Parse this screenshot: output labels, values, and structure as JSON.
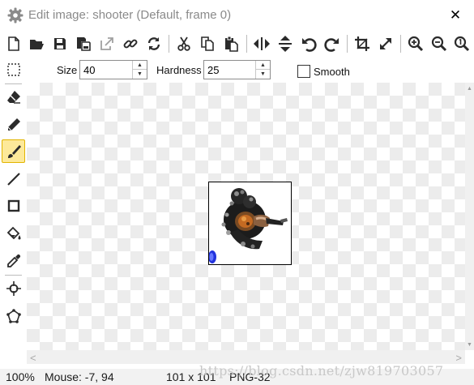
{
  "window": {
    "title": "Edit image: shooter (Default, frame 0)",
    "close_glyph": "✕",
    "app_icon": "gear-icon"
  },
  "toolbar": {
    "buttons": [
      {
        "name": "new-image-button",
        "icon": "new-file-icon"
      },
      {
        "name": "open-button",
        "icon": "folder-open-icon"
      },
      {
        "name": "save-button",
        "icon": "save-icon"
      },
      {
        "name": "save-copy-button",
        "icon": "save-copy-icon"
      },
      {
        "name": "export-button",
        "icon": "export-icon"
      },
      {
        "name": "link-button",
        "icon": "link-icon"
      },
      {
        "name": "refresh-button",
        "icon": "refresh-icon"
      },
      {
        "name": "cut-button",
        "icon": "scissors-icon"
      },
      {
        "name": "copy-button",
        "icon": "copy-icon"
      },
      {
        "name": "paste-button",
        "icon": "paste-icon"
      },
      {
        "name": "flip-horizontal-button",
        "icon": "flip-horizontal-icon"
      },
      {
        "name": "flip-vertical-button",
        "icon": "flip-vertical-icon"
      },
      {
        "name": "undo-button",
        "icon": "undo-icon"
      },
      {
        "name": "redo-button",
        "icon": "redo-icon"
      },
      {
        "name": "crop-button",
        "icon": "crop-icon"
      },
      {
        "name": "resize-button",
        "icon": "resize-icon"
      },
      {
        "name": "zoom-in-button",
        "icon": "zoom-in-icon"
      },
      {
        "name": "zoom-out-button",
        "icon": "zoom-out-icon"
      },
      {
        "name": "zoom-reset-button",
        "icon": "zoom-reset-icon"
      }
    ]
  },
  "options": {
    "size_label": "Size",
    "size_value": "40",
    "hardness_label": "Hardness",
    "hardness_value": "25",
    "smooth_label": "Smooth",
    "smooth_checked": false
  },
  "tools": {
    "active": "brush-tool",
    "items": [
      {
        "name": "select-tool",
        "icon": "marquee-select-icon"
      },
      {
        "name": "eraser-tool",
        "icon": "eraser-icon"
      },
      {
        "name": "pencil-tool",
        "icon": "pencil-icon"
      },
      {
        "name": "brush-tool",
        "icon": "brush-icon"
      },
      {
        "name": "line-tool",
        "icon": "line-icon"
      },
      {
        "name": "rectangle-tool",
        "icon": "rectangle-icon"
      },
      {
        "name": "fill-tool",
        "icon": "paint-bucket-icon"
      },
      {
        "name": "color-picker-tool",
        "icon": "eyedropper-icon"
      },
      {
        "name": "origin-tool",
        "icon": "crosshair-icon"
      },
      {
        "name": "collision-mask-tool",
        "icon": "polygon-mask-icon"
      }
    ]
  },
  "canvas": {
    "sprite_name": "shooter"
  },
  "status": {
    "zoom": "100%",
    "mouse": "Mouse: -7, 94",
    "dimensions": "101 x 101",
    "format": "PNG-32"
  },
  "watermark": "https://blog.csdn.net/zjw819703057",
  "colors": {
    "active_tool_bg": "#fde99a",
    "active_tool_border": "#e2b400",
    "checker_light": "#ffffff",
    "checker_dark": "#ececec",
    "icon_dark": "#2b2b2b",
    "icon_muted": "#a0a0a0"
  }
}
